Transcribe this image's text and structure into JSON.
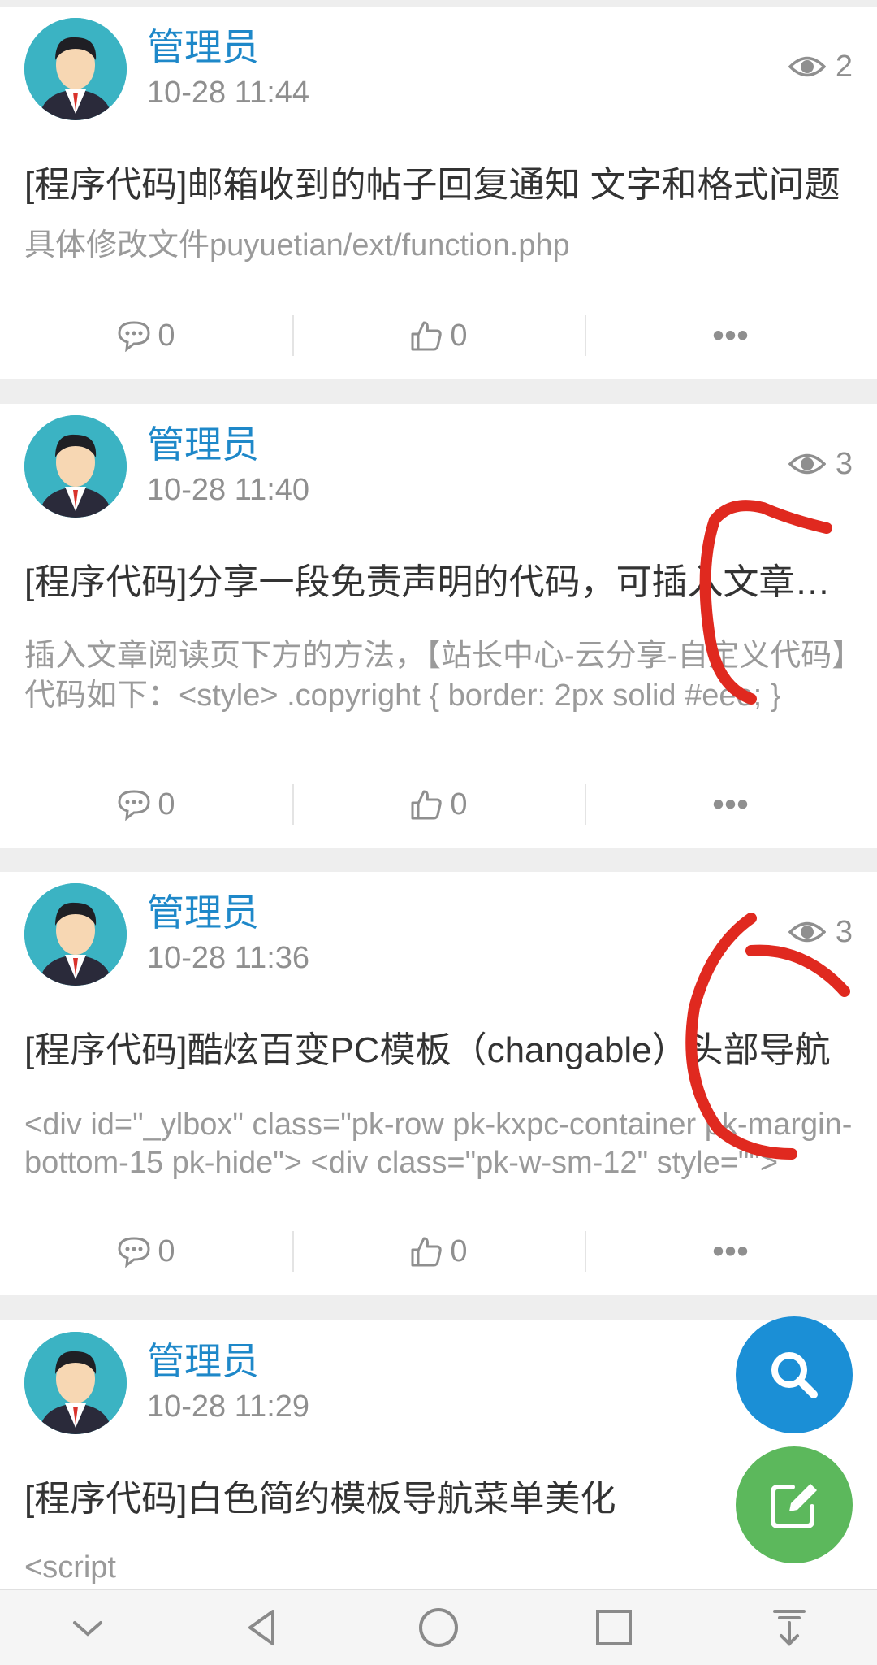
{
  "posts": [
    {
      "author": "管理员",
      "time": "10-28 11:44",
      "views": "2",
      "title": "[程序代码]邮箱收到的帖子回复通知 文字和格式问题",
      "excerpt": "具体修改文件puyuetian/ext/function.php",
      "comments": "0",
      "likes": "0"
    },
    {
      "author": "管理员",
      "time": "10-28 11:40",
      "views": "3",
      "title": "[程序代码]分享一段免责声明的代码，可插入文章阅读页",
      "excerpt": "插入文章阅读页下方的方法，【站长中心-云分享-自定义代码】代码如下：<style>    .copyright { border: 2px solid #eee; }",
      "comments": "0",
      "likes": "0"
    },
    {
      "author": "管理员",
      "time": "10-28 11:36",
      "views": "3",
      "title": "[程序代码]酷炫百变PC模板（changable）头部导航",
      "excerpt": "<div id=\"_ylbox\" class=\"pk-row pk-kxpc-container pk-margin-bottom-15 pk-hide\"> <div class=\"pk-w-sm-12\" style=\"\">",
      "comments": "0",
      "likes": "0"
    },
    {
      "author": "管理员",
      "time": "10-28 11:29",
      "views": "",
      "title": "[程序代码]白色简约模板导航菜单美化",
      "excerpt": "<script",
      "comments": "",
      "likes": ""
    }
  ],
  "icons": {
    "views": "eye-icon",
    "comments": "comment-icon",
    "likes": "thumbs-up-icon",
    "more": "more-icon",
    "fab_search": "search-icon",
    "fab_edit": "edit-icon",
    "nav": [
      "chevron-down-icon",
      "back-icon",
      "home-icon",
      "recents-icon",
      "notification-pull-icon"
    ]
  },
  "colors": {
    "author": "#1e88c9",
    "fab_search": "#1b8fd6",
    "fab_edit": "#5cb85c",
    "annotation": "#e0291f"
  }
}
